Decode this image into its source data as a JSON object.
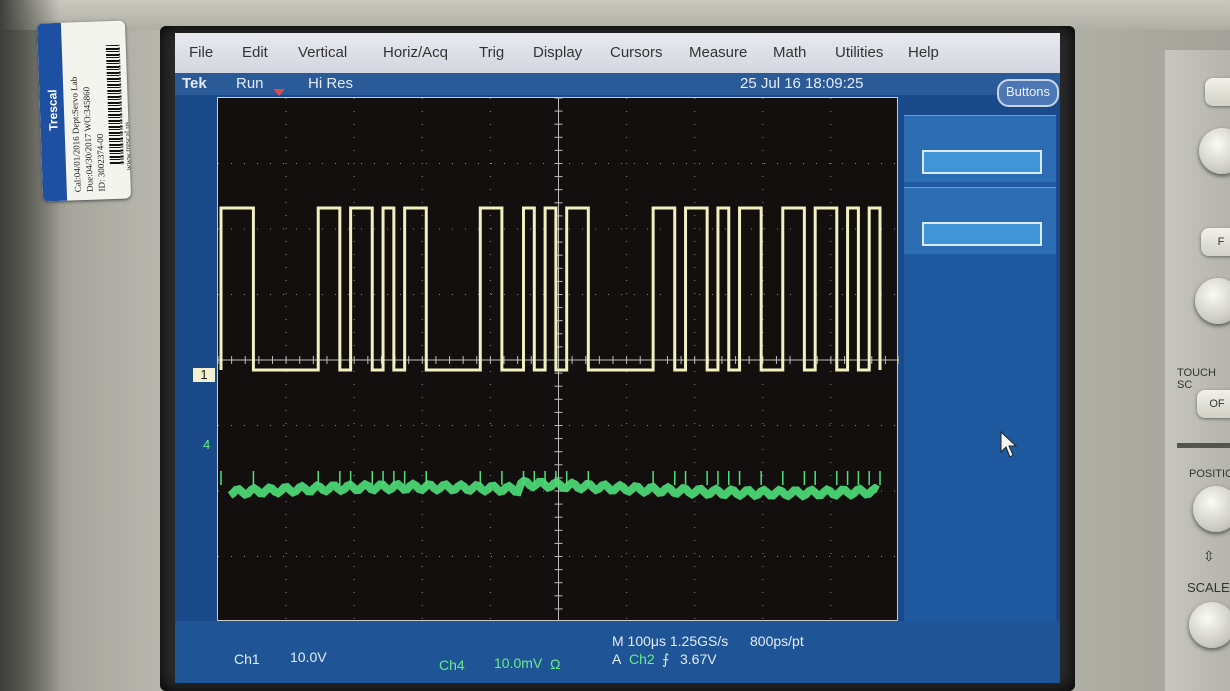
{
  "menu": {
    "items": [
      "File",
      "Edit",
      "Vertical",
      "Horiz/Acq",
      "Trig",
      "Display",
      "Cursors",
      "Measure",
      "Math",
      "Utilities",
      "Help"
    ]
  },
  "status": {
    "brand": "Tek",
    "run_state": "Run",
    "acq_mode": "Hi Res",
    "datetime": "25 Jul 16 18:09:25",
    "buttons_label": "Buttons"
  },
  "channel_markers": {
    "ch1": "1",
    "ch4": "4"
  },
  "readout": {
    "ch1_label": "Ch1",
    "ch1_scale": "10.0V",
    "ch4_label": "Ch4",
    "ch4_scale": "10.0mV",
    "ch4_coupling": "Ω",
    "timebase": "M 100μs 1.25GS/s",
    "pts": "800ps/pt",
    "trig_prefix": "A",
    "trig_source": "Ch2",
    "trig_slope": "⨍",
    "trig_level": "3.67V"
  },
  "waveforms": {
    "ch1_color": "#f3f0c0",
    "ch4_color": "#4fe07a",
    "ch1_high_segments_ms": [
      [
        0,
        0.15
      ],
      [
        0.45,
        0.55
      ],
      [
        0.6,
        0.7
      ],
      [
        0.75,
        0.8
      ],
      [
        0.85,
        0.95
      ],
      [
        1.2,
        1.3
      ],
      [
        1.4,
        1.45
      ],
      [
        1.5,
        1.55
      ],
      [
        1.6,
        1.7
      ],
      [
        2.0,
        2.1
      ],
      [
        2.15,
        2.25
      ],
      [
        2.3,
        2.35
      ],
      [
        2.4,
        2.5
      ],
      [
        2.6,
        2.7
      ],
      [
        2.75,
        2.85
      ],
      [
        2.9,
        2.95
      ],
      [
        3.0,
        3.05
      ]
    ]
  },
  "right_panel": {
    "touch_label": "TOUCH SC",
    "off_label": "OF",
    "position_label": "POSITIO",
    "scale_label": "SCALE",
    "f_label": "F"
  },
  "sticker": {
    "brand": "Trescal",
    "cal_line": "Cal:04/01/2016  Dept:Servo Lab",
    "due_line": "Due:04/30/2017  WO:345860",
    "id_line": "ID: 3002374-00",
    "url": "www.trescal.us"
  }
}
